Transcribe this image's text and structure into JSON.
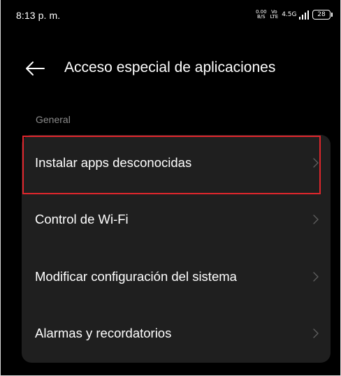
{
  "status_bar": {
    "time": "8:13 p. m.",
    "data_speed": "0.00",
    "data_speed_unit": "B/S",
    "volte_top": "Vo",
    "volte_bottom": "LTE",
    "network_type": "4.5G",
    "battery_level": "28",
    "icons": [
      "network-speed-icon",
      "volte-icon",
      "signal-icon",
      "battery-icon"
    ]
  },
  "header": {
    "back_icon": "arrow-left-icon",
    "title": "Acceso especial de aplicaciones"
  },
  "section": {
    "label": "General"
  },
  "settings": {
    "items": [
      {
        "label": "Instalar apps desconocidas",
        "chevron_icon": "chevron-right-icon",
        "highlighted": true
      },
      {
        "label": "Control de Wi-Fi",
        "chevron_icon": "chevron-right-icon",
        "highlighted": false
      },
      {
        "label": "Modificar configuración del sistema",
        "chevron_icon": "chevron-right-icon",
        "highlighted": false
      },
      {
        "label": "Alarmas y recordatorios",
        "chevron_icon": "chevron-right-icon",
        "highlighted": false
      }
    ]
  },
  "colors": {
    "background": "#000000",
    "card": "#1f1f1f",
    "text": "#ffffff",
    "muted_text": "#8c8c8c",
    "chevron": "#5e5e5e",
    "highlight": "#e0262c"
  }
}
